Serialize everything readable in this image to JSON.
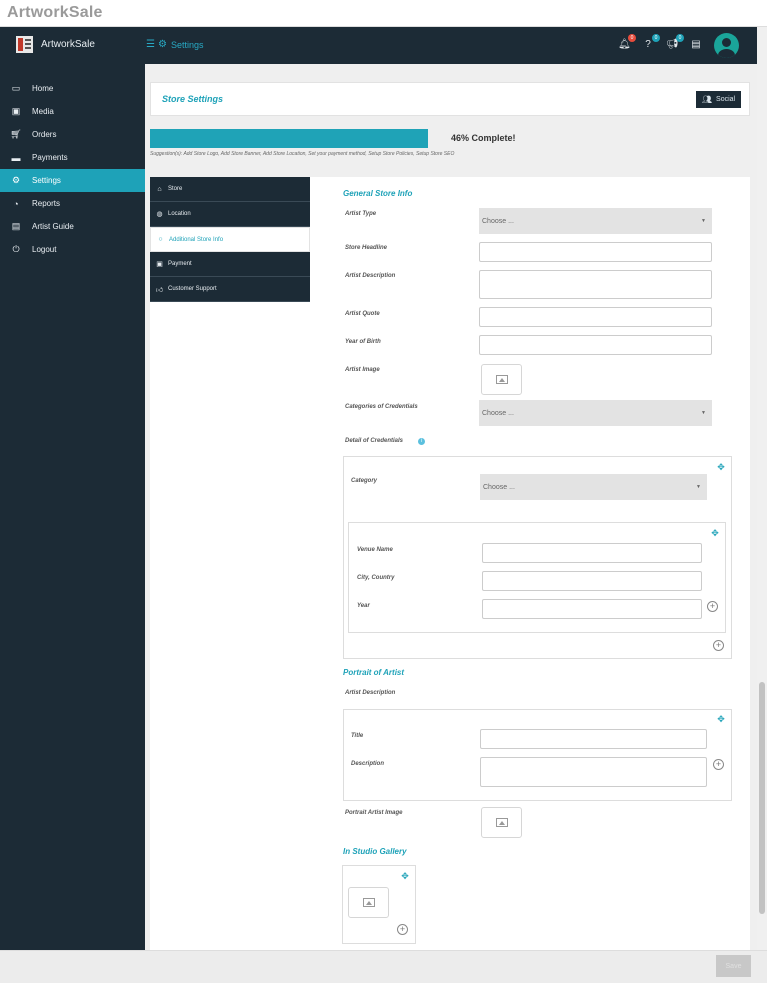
{
  "window": {
    "title": "ArtworkSale"
  },
  "topbar": {
    "brand_name": "ArtworkSale",
    "breadcrumb": "Settings",
    "icons": [
      {
        "name": "bell-icon",
        "badge": "0",
        "badge_color": "#e74c3c"
      },
      {
        "name": "help-icon",
        "badge": "0",
        "badge_color": "#1ea2b8"
      },
      {
        "name": "megaphone-icon",
        "badge": "0",
        "badge_color": "#1ea2b8"
      },
      {
        "name": "book-icon"
      }
    ],
    "accent": "#1ea2b8",
    "bg": "#1c2b36"
  },
  "sidebar": {
    "items": [
      {
        "label": "Home",
        "icon": "monitor-icon"
      },
      {
        "label": "Media",
        "icon": "image-icon"
      },
      {
        "label": "Orders",
        "icon": "cart-icon"
      },
      {
        "label": "Payments",
        "icon": "card-icon"
      },
      {
        "label": "Settings",
        "icon": "settings-icon",
        "active": true
      },
      {
        "label": "Reports",
        "icon": "pie-chart-icon"
      },
      {
        "label": "Artist Guide",
        "icon": "guide-icon"
      },
      {
        "label": "Logout",
        "icon": "power-icon"
      }
    ]
  },
  "header": {
    "title": "Store Settings",
    "social_label": "Social"
  },
  "progress": {
    "percent": 46,
    "label": "46% Complete!",
    "suggestion": "Suggestion(s): Add Store Logo, Add Store Banner, Add Store Location, Set your payment method, Setup Store Policies, Setup Store SEO"
  },
  "tabs": [
    {
      "label": "Store",
      "icon": "store-icon"
    },
    {
      "label": "Location",
      "icon": "globe-icon"
    },
    {
      "label": "Additional Store Info",
      "icon": "circle-icon",
      "active": true
    },
    {
      "label": "Payment",
      "icon": "money-icon"
    },
    {
      "label": "Customer Support",
      "icon": "thumbs-up-icon"
    }
  ],
  "form": {
    "general_heading": "General Store Info",
    "artist_type_label": "Artist Type",
    "artist_type_value": "Choose ...",
    "store_headline_label": "Store Headline",
    "artist_description_label": "Artist Description",
    "artist_quote_label": "Artist Quote",
    "year_of_birth_label": "Year of Birth",
    "artist_image_label": "Artist Image",
    "categories_label": "Categories of Credentials",
    "categories_value": "Choose ...",
    "detail_label": "Detail of Credentials",
    "category_label": "Category",
    "category_value": "Choose ...",
    "venue_name_label": "Venue Name",
    "city_country_label": "City, Country",
    "year_label": "Year",
    "portrait_heading": "Portrait of Artist",
    "portrait_desc_label": "Artist Description",
    "title_label": "Title",
    "description_label": "Description",
    "portrait_image_label": "Portrait Artist Image",
    "gallery_heading": "In Studio Gallery"
  },
  "footer": {
    "submit_label": "Save"
  }
}
